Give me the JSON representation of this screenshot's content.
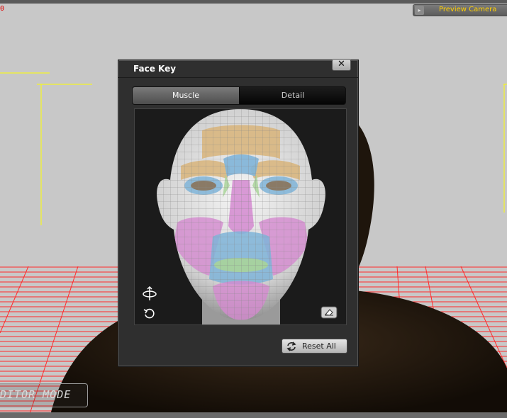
{
  "viewport": {
    "corner_mark": "0",
    "camera": {
      "label": "Preview Camera",
      "arrow": "▸"
    },
    "mode_label": "DITOR MODE"
  },
  "panel": {
    "title": "Face Key",
    "close_label": "✕",
    "tabs": [
      {
        "label": "Muscle",
        "active": true
      },
      {
        "label": "Detail",
        "active": false
      }
    ],
    "face_regions": [
      "forehead",
      "brows",
      "eyes",
      "nose",
      "cheeks",
      "upper-lip",
      "mouth",
      "chin"
    ],
    "reset_label": "Reset All"
  },
  "colors": {
    "camera_text": "#ffd000",
    "grid": "#ff2020",
    "guide": "#ffff00",
    "region_tan": "#d8b47a",
    "region_blue": "#7fb4d8",
    "region_green": "#a9d49a",
    "region_pink": "#d48ad0"
  }
}
